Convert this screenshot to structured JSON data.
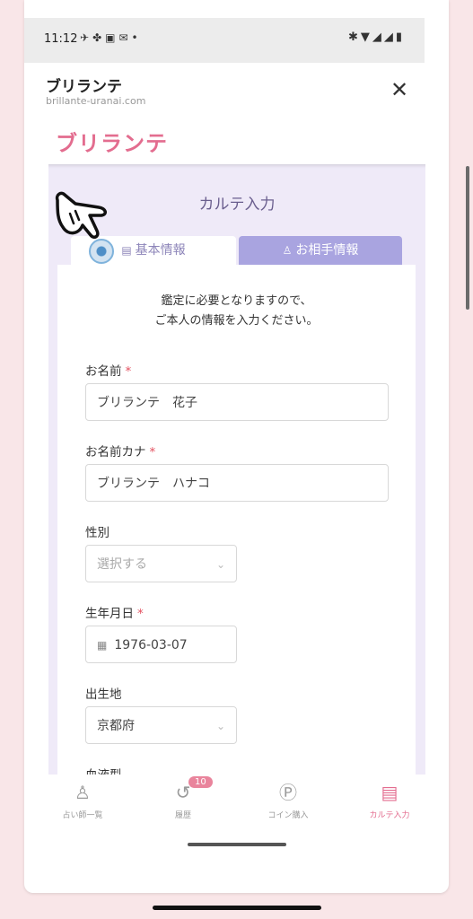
{
  "status_bar": {
    "time": "11:12",
    "left_icons": [
      "notification-icon",
      "fan-icon",
      "calendar-icon",
      "gmail-icon",
      "dot-icon"
    ],
    "right_icons": [
      "bluetooth-icon",
      "wifi-icon",
      "signal-icon",
      "signal-icon",
      "battery-icon"
    ]
  },
  "browser": {
    "title": "ブリランテ",
    "url": "brillante-uranai.com",
    "close_label": "✕"
  },
  "brand": {
    "logo_text": "ブリランテ",
    "color": "#e36d8f"
  },
  "page": {
    "heading": "カルテ入力"
  },
  "tabs": [
    {
      "label": "基本情報",
      "icon": "document-icon",
      "active": true
    },
    {
      "label": "お相手情報",
      "icon": "person-icon",
      "active": false
    }
  ],
  "form": {
    "intro_line1": "鑑定に必要となりますので、",
    "intro_line2": "ご本人の情報を入力ください。",
    "required_mark": "*",
    "name": {
      "label": "お名前",
      "value": "ブリランテ　花子"
    },
    "name_kana": {
      "label": "お名前カナ",
      "value": "ブリランテ　ハナコ"
    },
    "gender": {
      "label": "性別",
      "placeholder": "選択する"
    },
    "birthdate": {
      "label": "生年月日",
      "value": "1976-03-07"
    },
    "birthplace": {
      "label": "出生地",
      "value": "京都府"
    },
    "blood_type": {
      "label": "血液型"
    }
  },
  "bottom_nav": {
    "items": [
      {
        "label": "占い師一覧",
        "icon": "person-icon"
      },
      {
        "label": "履歴",
        "icon": "history-icon",
        "badge": "10"
      },
      {
        "label": "コイン購入",
        "icon": "coin-icon"
      },
      {
        "label": "カルテ入力",
        "icon": "document-icon",
        "active": true
      }
    ]
  },
  "colors": {
    "accent_pink": "#e36d8f",
    "tab_inactive_bg": "#a9a4e0",
    "content_bg": "#efeaf8",
    "required_red": "#e3505f"
  }
}
